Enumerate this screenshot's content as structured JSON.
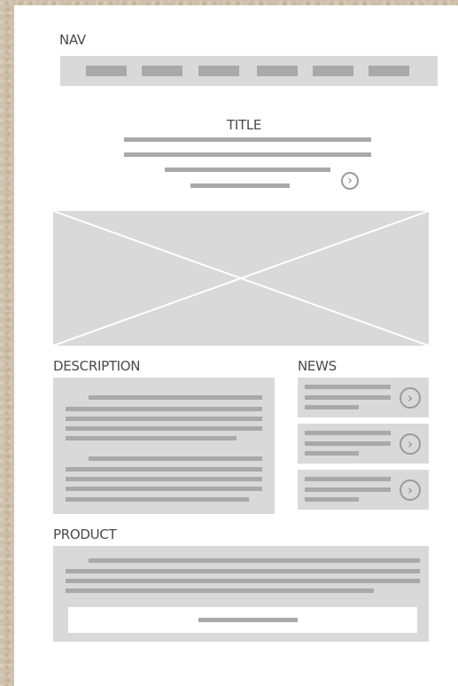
{
  "nav": {
    "label": "NAV",
    "item_count": 6
  },
  "title": {
    "label": "TITLE"
  },
  "description": {
    "label": "DESCRIPTION"
  },
  "news": {
    "label": "NEWS",
    "item_count": 3
  },
  "product": {
    "label": "PRODUCT"
  },
  "icons": {
    "arrow": "chevron-right-circle-icon",
    "image": "image-placeholder-cross"
  },
  "colors": {
    "placeholder_fill": "#d9d9d9",
    "text_line": "#a9a9a9",
    "sheet": "#ffffff",
    "backdrop": "#cdbfa8"
  }
}
